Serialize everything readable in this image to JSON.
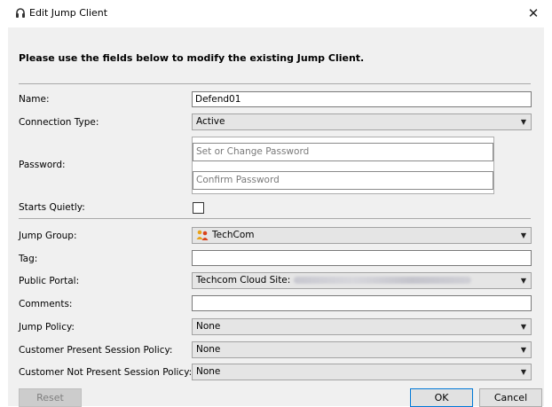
{
  "window": {
    "title": "Edit Jump Client",
    "close_glyph": "✕",
    "icon": "headset-icon"
  },
  "intro_text": "Please use the fields below to modify the existing Jump Client.",
  "form": {
    "name": {
      "label": "Name:",
      "value": "Defend01"
    },
    "connection_type": {
      "label": "Connection Type:",
      "value": "Active"
    },
    "password": {
      "label": "Password:",
      "placeholder": "Set or Change Password",
      "confirm_placeholder": "Confirm Password"
    },
    "starts_quietly": {
      "label": "Starts Quietly:",
      "checked": false
    },
    "jump_group": {
      "label": "Jump Group:",
      "value": "TechCom",
      "icon": "group-icon"
    },
    "tag": {
      "label": "Tag:",
      "value": ""
    },
    "public_portal": {
      "label": "Public Portal:",
      "value": "Techcom Cloud Site:"
    },
    "comments": {
      "label": "Comments:",
      "value": ""
    },
    "jump_policy": {
      "label": "Jump Policy:",
      "value": "None"
    },
    "customer_present_policy": {
      "label": "Customer Present Session Policy:",
      "value": "None"
    },
    "customer_not_present_policy": {
      "label": "Customer Not Present Session Policy:",
      "value": "None"
    }
  },
  "buttons": {
    "reset": "Reset",
    "ok": "OK",
    "cancel": "Cancel"
  },
  "colors": {
    "panel_bg": "#f0f0f0",
    "select_bg": "#e5e5e5",
    "ok_border": "#0078d7"
  }
}
